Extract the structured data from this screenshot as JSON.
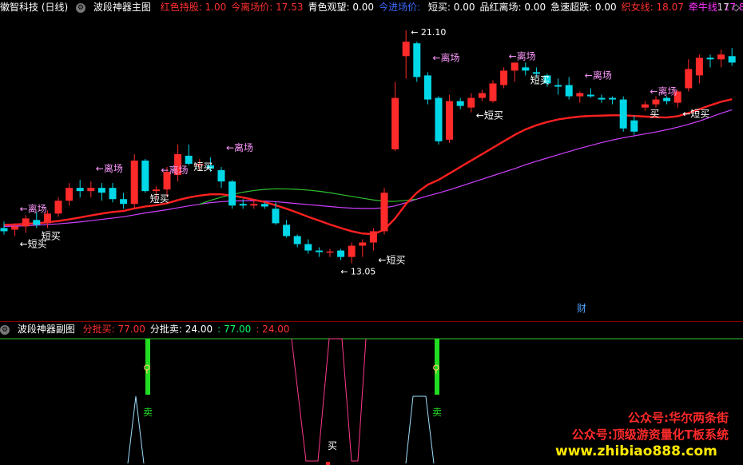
{
  "header": {
    "app_title": "徽智科技 (日线)",
    "indicator_title": "波段神器主图",
    "fields": [
      {
        "label": "红色持股: 1.00",
        "color": "#ff3030"
      },
      {
        "label": "今离场价: 17.53",
        "color": "#ff3030"
      },
      {
        "label": "青色观望: 0.00",
        "color": "#ffffff"
      },
      {
        "label": "今进场价: ",
        "color": "#3a6bff"
      },
      {
        "label": "短买: 0.00",
        "color": "#ffffff"
      },
      {
        "label": "品红离场: 0.00",
        "color": "#ffffff"
      },
      {
        "label": "急速超跌: 0.00",
        "color": "#ffffff"
      },
      {
        "label": "织女线: 18.07",
        "color": "#ff3030"
      },
      {
        "label": "牵牛线: 17.84",
        "color": "#ff33ff"
      }
    ],
    "corner_text": "17"
  },
  "sub_header": {
    "title": "波段神器副图",
    "fields": [
      {
        "label": "分批买: 77.00",
        "color": "#ff3030"
      },
      {
        "label": "分批卖: 24.00",
        "color": "#ffffff"
      },
      {
        "label": ": 77.00",
        "color": "#00ff66"
      },
      {
        "label": ": 24.00",
        "color": "#ff3030"
      }
    ]
  },
  "colors": {
    "up": "#ff2a2a",
    "down": "#00d8e8",
    "ma_red": "#ff2020",
    "ma_magenta": "#d040ff",
    "ma_green": "#30c030",
    "white_line": "#ffffff"
  },
  "chart_data": [
    {
      "type": "candlestick",
      "title": "波段神器主图",
      "ylim": [
        12.2,
        21.6
      ],
      "max_label": "21.10",
      "min_label": "13.05",
      "candles": [
        {
          "o": 14.95,
          "h": 15.15,
          "l": 14.75,
          "c": 14.85,
          "u": false
        },
        {
          "o": 14.9,
          "h": 15.1,
          "l": 14.7,
          "c": 15.0,
          "u": true
        },
        {
          "o": 15.0,
          "h": 15.35,
          "l": 14.8,
          "c": 15.25,
          "u": true
        },
        {
          "o": 15.2,
          "h": 15.45,
          "l": 14.95,
          "c": 15.05,
          "u": false
        },
        {
          "o": 15.1,
          "h": 15.5,
          "l": 14.95,
          "c": 15.4,
          "u": true
        },
        {
          "o": 15.4,
          "h": 15.9,
          "l": 15.3,
          "c": 15.8,
          "u": true
        },
        {
          "o": 15.8,
          "h": 16.35,
          "l": 15.65,
          "c": 16.2,
          "u": true
        },
        {
          "o": 16.2,
          "h": 16.45,
          "l": 15.9,
          "c": 16.1,
          "u": false
        },
        {
          "o": 16.1,
          "h": 16.4,
          "l": 15.9,
          "c": 16.2,
          "u": true
        },
        {
          "o": 16.2,
          "h": 16.35,
          "l": 15.8,
          "c": 16.05,
          "u": false
        },
        {
          "o": 16.2,
          "h": 16.35,
          "l": 15.75,
          "c": 15.85,
          "u": false
        },
        {
          "o": 15.85,
          "h": 16.05,
          "l": 15.55,
          "c": 15.7,
          "u": false
        },
        {
          "o": 15.7,
          "h": 17.25,
          "l": 15.55,
          "c": 17.05,
          "u": true
        },
        {
          "o": 17.05,
          "h": 17.1,
          "l": 16.05,
          "c": 16.1,
          "u": false
        },
        {
          "o": 16.1,
          "h": 16.25,
          "l": 15.85,
          "c": 16.15,
          "u": true
        },
        {
          "o": 16.15,
          "h": 16.85,
          "l": 15.9,
          "c": 16.7,
          "u": true
        },
        {
          "o": 16.6,
          "h": 17.55,
          "l": 16.4,
          "c": 17.25,
          "u": true
        },
        {
          "o": 17.2,
          "h": 17.55,
          "l": 16.9,
          "c": 16.95,
          "u": false
        },
        {
          "o": 16.95,
          "h": 17.1,
          "l": 16.75,
          "c": 16.9,
          "u": true
        },
        {
          "o": 16.9,
          "h": 17.15,
          "l": 16.7,
          "c": 16.8,
          "u": false
        },
        {
          "o": 16.75,
          "h": 16.85,
          "l": 16.2,
          "c": 16.4,
          "u": false
        },
        {
          "o": 16.4,
          "h": 16.45,
          "l": 15.55,
          "c": 15.65,
          "u": false
        },
        {
          "o": 15.7,
          "h": 15.85,
          "l": 15.55,
          "c": 15.65,
          "u": false
        },
        {
          "o": 15.65,
          "h": 15.8,
          "l": 15.55,
          "c": 15.7,
          "u": true
        },
        {
          "o": 15.7,
          "h": 15.75,
          "l": 15.55,
          "c": 15.62,
          "u": false
        },
        {
          "o": 15.55,
          "h": 15.75,
          "l": 15.05,
          "c": 15.1,
          "u": false
        },
        {
          "o": 15.05,
          "h": 15.2,
          "l": 14.65,
          "c": 14.7,
          "u": false
        },
        {
          "o": 14.7,
          "h": 14.75,
          "l": 14.35,
          "c": 14.45,
          "u": false
        },
        {
          "o": 14.45,
          "h": 14.6,
          "l": 14.15,
          "c": 14.25,
          "u": false
        },
        {
          "o": 14.25,
          "h": 14.35,
          "l": 14.05,
          "c": 14.2,
          "u": false
        },
        {
          "o": 14.2,
          "h": 14.3,
          "l": 14.05,
          "c": 14.22,
          "u": true
        },
        {
          "o": 14.25,
          "h": 14.3,
          "l": 13.95,
          "c": 14.05,
          "u": false
        },
        {
          "o": 14.05,
          "h": 14.5,
          "l": 13.85,
          "c": 14.4,
          "u": true
        },
        {
          "o": 14.4,
          "h": 14.6,
          "l": 14.05,
          "c": 14.5,
          "u": true
        },
        {
          "o": 14.5,
          "h": 14.95,
          "l": 14.25,
          "c": 14.85,
          "u": true
        },
        {
          "o": 14.85,
          "h": 16.2,
          "l": 14.75,
          "c": 16.05,
          "u": true
        },
        {
          "o": 17.4,
          "h": 19.5,
          "l": 17.35,
          "c": 19.0,
          "u": true
        },
        {
          "o": 20.3,
          "h": 21.1,
          "l": 19.6,
          "c": 20.75,
          "u": true
        },
        {
          "o": 20.7,
          "h": 20.75,
          "l": 19.5,
          "c": 19.65,
          "u": false
        },
        {
          "o": 19.7,
          "h": 19.8,
          "l": 18.8,
          "c": 18.95,
          "u": false
        },
        {
          "o": 19.0,
          "h": 19.05,
          "l": 17.55,
          "c": 17.65,
          "u": false
        },
        {
          "o": 17.7,
          "h": 19.1,
          "l": 17.6,
          "c": 18.9,
          "u": true
        },
        {
          "o": 18.9,
          "h": 19.0,
          "l": 18.65,
          "c": 18.75,
          "u": false
        },
        {
          "o": 18.7,
          "h": 19.15,
          "l": 18.55,
          "c": 19.0,
          "u": true
        },
        {
          "o": 19.0,
          "h": 19.25,
          "l": 18.9,
          "c": 19.15,
          "u": true
        },
        {
          "o": 18.9,
          "h": 19.55,
          "l": 18.85,
          "c": 19.45,
          "u": true
        },
        {
          "o": 19.4,
          "h": 19.95,
          "l": 19.3,
          "c": 19.85,
          "u": true
        },
        {
          "o": 19.85,
          "h": 20.0,
          "l": 19.5,
          "c": 20.1,
          "u": true
        },
        {
          "o": 19.95,
          "h": 20.1,
          "l": 19.7,
          "c": 19.85,
          "u": false
        },
        {
          "o": 19.8,
          "h": 19.95,
          "l": 19.65,
          "c": 19.75,
          "u": false
        },
        {
          "o": 19.7,
          "h": 19.75,
          "l": 19.35,
          "c": 19.45,
          "u": false
        },
        {
          "o": 19.4,
          "h": 19.6,
          "l": 19.1,
          "c": 19.35,
          "u": false
        },
        {
          "o": 19.4,
          "h": 19.65,
          "l": 18.95,
          "c": 19.05,
          "u": false
        },
        {
          "o": 19.05,
          "h": 19.2,
          "l": 18.85,
          "c": 19.15,
          "u": true
        },
        {
          "o": 19.1,
          "h": 19.3,
          "l": 19.0,
          "c": 19.05,
          "u": false
        },
        {
          "o": 19.0,
          "h": 19.1,
          "l": 18.85,
          "c": 18.95,
          "u": false
        },
        {
          "o": 19.0,
          "h": 19.05,
          "l": 18.8,
          "c": 18.95,
          "u": false
        },
        {
          "o": 18.95,
          "h": 19.05,
          "l": 17.95,
          "c": 18.05,
          "u": false
        },
        {
          "o": 18.3,
          "h": 18.45,
          "l": 17.85,
          "c": 17.95,
          "u": false
        },
        {
          "o": 18.7,
          "h": 18.9,
          "l": 18.6,
          "c": 18.8,
          "u": true
        },
        {
          "o": 18.8,
          "h": 19.05,
          "l": 18.7,
          "c": 18.95,
          "u": true
        },
        {
          "o": 19.0,
          "h": 19.05,
          "l": 18.8,
          "c": 18.9,
          "u": false
        },
        {
          "o": 18.85,
          "h": 19.25,
          "l": 18.7,
          "c": 19.2,
          "u": true
        },
        {
          "o": 19.3,
          "h": 20.2,
          "l": 19.2,
          "c": 19.9,
          "u": true
        },
        {
          "o": 19.7,
          "h": 20.35,
          "l": 19.45,
          "c": 20.25,
          "u": true
        },
        {
          "o": 20.25,
          "h": 20.35,
          "l": 19.95,
          "c": 20.2,
          "u": false
        },
        {
          "o": 20.2,
          "h": 20.5,
          "l": 19.95,
          "c": 20.35,
          "u": true
        },
        {
          "o": 20.3,
          "h": 20.55,
          "l": 20.0,
          "c": 20.1,
          "u": false
        }
      ],
      "lines": {
        "red": [
          15.05,
          15.06,
          15.08,
          15.1,
          15.13,
          15.17,
          15.22,
          15.28,
          15.34,
          15.4,
          15.45,
          15.48,
          15.56,
          15.62,
          15.66,
          15.72,
          15.82,
          15.9,
          15.96,
          16.0,
          16.0,
          15.96,
          15.9,
          15.83,
          15.76,
          15.66,
          15.55,
          15.43,
          15.3,
          15.18,
          15.06,
          14.95,
          14.85,
          14.78,
          14.76,
          14.9,
          15.25,
          15.7,
          16.05,
          16.3,
          16.45,
          16.65,
          16.85,
          17.05,
          17.25,
          17.45,
          17.65,
          17.85,
          18.02,
          18.15,
          18.25,
          18.33,
          18.38,
          18.42,
          18.44,
          18.45,
          18.46,
          18.46,
          18.44,
          18.42,
          18.4,
          18.39,
          18.43,
          18.53,
          18.65,
          18.77,
          18.88,
          18.96
        ],
        "magenta": [
          15.0,
          15.01,
          15.02,
          15.04,
          15.06,
          15.08,
          15.11,
          15.14,
          15.18,
          15.22,
          15.26,
          15.3,
          15.36,
          15.42,
          15.47,
          15.52,
          15.58,
          15.64,
          15.69,
          15.74,
          15.77,
          15.79,
          15.8,
          15.8,
          15.79,
          15.77,
          15.74,
          15.71,
          15.68,
          15.65,
          15.62,
          15.59,
          15.57,
          15.56,
          15.56,
          15.58,
          15.64,
          15.74,
          15.85,
          15.95,
          16.04,
          16.14,
          16.25,
          16.36,
          16.47,
          16.58,
          16.69,
          16.8,
          16.92,
          17.03,
          17.13,
          17.23,
          17.33,
          17.43,
          17.52,
          17.61,
          17.69,
          17.76,
          17.82,
          17.88,
          17.94,
          18.01,
          18.09,
          18.18,
          18.28,
          18.4,
          18.52,
          18.63
        ],
        "green_segment_start": 18,
        "green_segment_end": 38
      },
      "annotations": [
        {
          "i": 1,
          "text": "←离场",
          "kind": "exit",
          "dy": -14
        },
        {
          "i": 1,
          "text": "←短买",
          "kind": "buy",
          "dy": 14
        },
        {
          "i": 3,
          "text": "短买",
          "kind": "buy",
          "dy": 14
        },
        {
          "i": 8,
          "text": "←离场",
          "kind": "exit",
          "dy": -12
        },
        {
          "i": 13,
          "text": "短买",
          "kind": "buy",
          "dy": 12
        },
        {
          "i": 14,
          "text": "←离场",
          "kind": "exit",
          "dy": -16
        },
        {
          "i": 17,
          "text": "短买",
          "kind": "buy",
          "dy": 6
        },
        {
          "i": 20,
          "text": "←离场",
          "kind": "exit",
          "dy": -20
        },
        {
          "i": 34,
          "text": "←短买",
          "kind": "buy",
          "dy": 16
        },
        {
          "i": 39,
          "text": "←离场",
          "kind": "exit",
          "dy": -14
        },
        {
          "i": 43,
          "text": "←短买",
          "kind": "buy",
          "dy": 8
        },
        {
          "i": 46,
          "text": "←离场",
          "kind": "exit",
          "dy": -10
        },
        {
          "i": 48,
          "text": "短买",
          "kind": "buy",
          "dy": 10
        },
        {
          "i": 53,
          "text": "←离场",
          "kind": "exit",
          "dy": -16
        },
        {
          "i": 59,
          "text": "←离场",
          "kind": "exit",
          "dy": -8
        },
        {
          "i": 59,
          "text": "买",
          "kind": "buy",
          "dy": 8
        },
        {
          "i": 62,
          "text": "←短买",
          "kind": "buy",
          "dy": 12
        }
      ],
      "finance_marker": "财"
    },
    {
      "type": "line",
      "title": "波段神器副图",
      "series": [
        {
          "name": "分批买",
          "values": [
            77.0
          ]
        },
        {
          "name": "分批卖",
          "values": [
            24.0
          ]
        }
      ],
      "sell_label": "卖",
      "buy_label": "买",
      "top_level": 77.0
    }
  ],
  "watermark": {
    "line1": "公众号:华尔两条街",
    "line2": "公众号:顶级游资量化T板系统",
    "line3": "www.zhibiao888.com"
  }
}
